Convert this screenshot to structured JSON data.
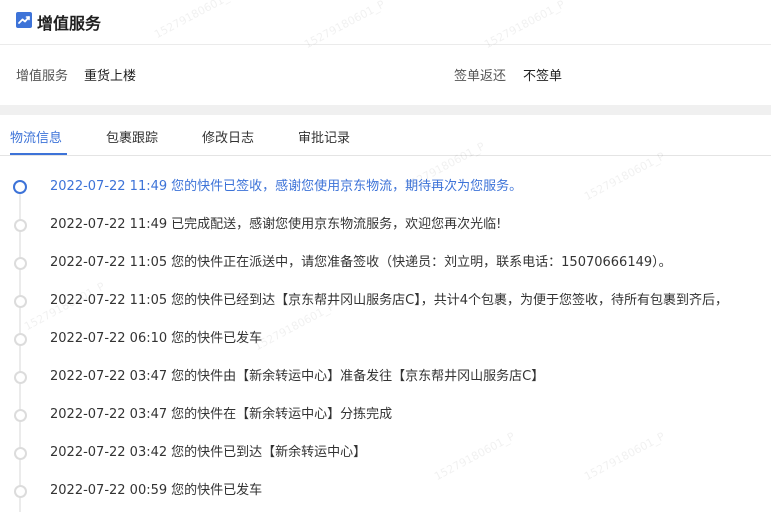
{
  "section": {
    "title": "增值服务"
  },
  "info": {
    "service_label": "增值服务",
    "service_value": "重货上楼",
    "return_label": "签单返还",
    "return_value": "不签单"
  },
  "tabs": [
    {
      "label": "物流信息",
      "active": true
    },
    {
      "label": "包裹跟踪",
      "active": false
    },
    {
      "label": "修改日志",
      "active": false
    },
    {
      "label": "审批记录",
      "active": false
    }
  ],
  "timeline": [
    {
      "time": "2022-07-22 11:49",
      "text": "您的快件已签收，感谢您使用京东物流，期待再次为您服务。"
    },
    {
      "time": "2022-07-22 11:49",
      "text": "已完成配送，感谢您使用京东物流服务，欢迎您再次光临!"
    },
    {
      "time": "2022-07-22 11:05",
      "text": "您的快件正在派送中，请您准备签收（快递员：刘立明，联系电话：15070666149）。"
    },
    {
      "time": "2022-07-22 11:05",
      "text": "您的快件已经到达【京东帮井冈山服务店C】，共计4个包裹，为便于您签收，待所有包裹到齐后，"
    },
    {
      "time": "2022-07-22 06:10",
      "text": "您的快件已发车"
    },
    {
      "time": "2022-07-22 03:47",
      "text": "您的快件由【新余转运中心】准备发往【京东帮井冈山服务店C】"
    },
    {
      "time": "2022-07-22 03:47",
      "text": "您的快件在【新余转运中心】分拣完成"
    },
    {
      "time": "2022-07-22 03:42",
      "text": "您的快件已到达【新余转运中心】"
    },
    {
      "time": "2022-07-22 00:59",
      "text": "您的快件已发车"
    }
  ],
  "watermark_text": "15279180601_P",
  "colors": {
    "accent": "#3d73d8",
    "dot_inactive": "#dcdcdc",
    "separator": "#f0f0f0"
  }
}
